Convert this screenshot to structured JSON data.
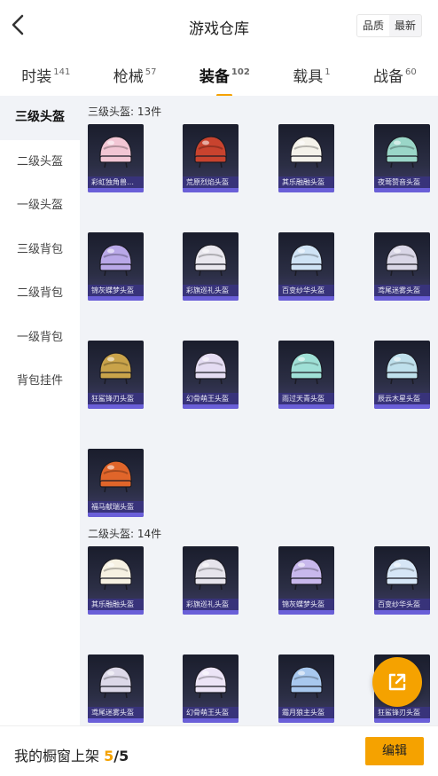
{
  "header": {
    "title": "游戏仓库",
    "sort": [
      "品质",
      "最新"
    ],
    "active_sort": 0
  },
  "tabs": [
    {
      "label": "时装",
      "count": "141"
    },
    {
      "label": "枪械",
      "count": "57"
    },
    {
      "label": "装备",
      "count": "102"
    },
    {
      "label": "载具",
      "count": "1"
    },
    {
      "label": "战备",
      "count": "60"
    }
  ],
  "active_tab": 2,
  "side_menu": [
    "三级头盔",
    "二级头盔",
    "一级头盔",
    "三级背包",
    "二级背包",
    "一级背包",
    "背包挂件"
  ],
  "active_side": 0,
  "sections": [
    {
      "title": "三级头盔: 13件",
      "items": [
        {
          "name": "彩虹独角兽头盔",
          "color": "#f2c6d4"
        },
        {
          "name": "荒原烈焰头盔",
          "color": "#c8432e"
        },
        {
          "name": "其乐融融头盔",
          "color": "#f4f2ea"
        },
        {
          "name": "夜莺赞音头盔",
          "color": "#9ad6c8"
        },
        {
          "name": "锦灰蝶梦头盔",
          "color": "#b9a8e8"
        },
        {
          "name": "彩旗巡礼头盔",
          "color": "#e9e7ee"
        },
        {
          "name": "百变纱华头盔",
          "color": "#cfe3f5"
        },
        {
          "name": "鸢尾迷雾头盔",
          "color": "#d9d6e6"
        },
        {
          "name": "狂鲨锋刃头盔",
          "color": "#c9a34a"
        },
        {
          "name": "幻骨萌王头盔",
          "color": "#e4dcf2"
        },
        {
          "name": "雨过天青头盔",
          "color": "#9fe0d6"
        },
        {
          "name": "辰云木星头盔",
          "color": "#bfe0ec"
        },
        {
          "name": "福马献瑞头盔",
          "color": "#e0652a"
        }
      ]
    },
    {
      "title": "二级头盔: 14件",
      "items": [
        {
          "name": "其乐融融头盔",
          "color": "#f6f1e2"
        },
        {
          "name": "彩旗巡礼头盔",
          "color": "#e6e4ec"
        },
        {
          "name": "锦灰蝶梦头盔",
          "color": "#c8b8ec"
        },
        {
          "name": "百变纱华头盔",
          "color": "#d6e6f6"
        },
        {
          "name": "鸢尾迷雾头盔",
          "color": "#dcd8e8"
        },
        {
          "name": "幻骨萌王头盔",
          "color": "#ece4f6"
        },
        {
          "name": "霜月狼主头盔",
          "color": "#a8c8ee"
        },
        {
          "name": "狂鲨锋刃头盔",
          "color": "#c9a34a"
        }
      ]
    }
  ],
  "bottom": {
    "shelf_label": "我的橱窗上架",
    "count": "5",
    "total": "/5",
    "edit_label": "编辑"
  },
  "fab_icon": "share-out-icon"
}
